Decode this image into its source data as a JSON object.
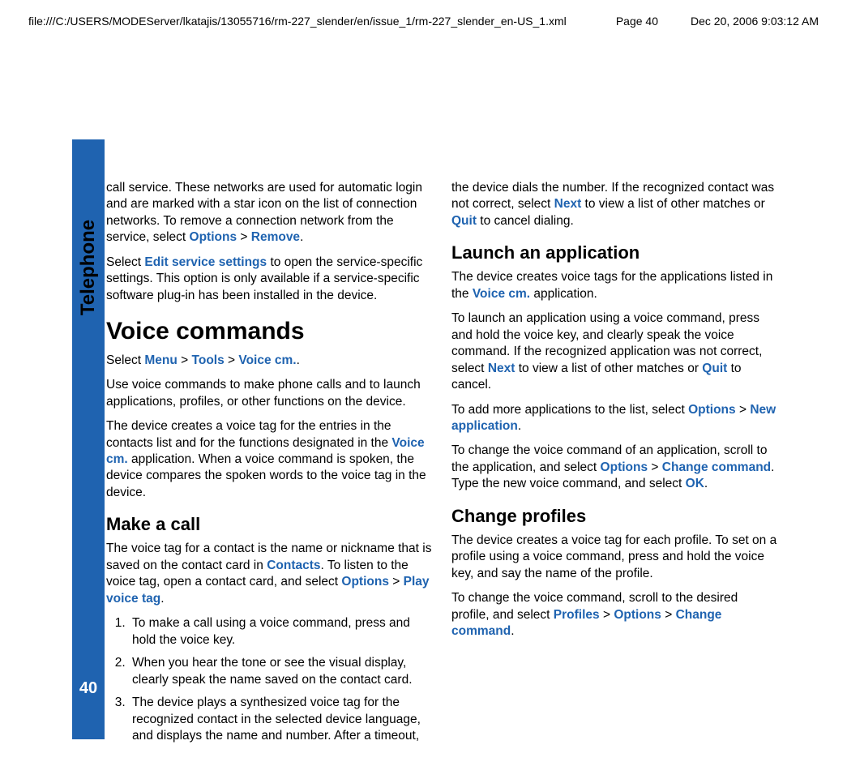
{
  "header": {
    "path": "file:///C:/USERS/MODEServer/lkatajis/13055716/rm-227_slender/en/issue_1/rm-227_slender_en-US_1.xml",
    "page": "Page 40",
    "date": "Dec 20, 2006 9:03:12 AM"
  },
  "side": {
    "label": "Telephone",
    "page_number": "40"
  },
  "left": {
    "p1a": "call service. These networks are used for automatic login and are marked with a star icon on the list of connection networks. To remove a connection network from the service, select ",
    "p1_opt": "Options",
    "p1_gt": " > ",
    "p1_rem": "Remove",
    "p1b": ".",
    "p2a": "Select ",
    "p2_edit": "Edit service settings",
    "p2b": " to open the service-specific settings. This option is only available if a service-specific software plug-in has been installed in the device.",
    "h1": "Voice commands",
    "p3a": "Select ",
    "p3_menu": "Menu",
    "p3_gt1": " > ",
    "p3_tools": "Tools",
    "p3_gt2": " > ",
    "p3_vc": "Voice cm.",
    "p3b": ".",
    "p4": "Use voice commands to make phone calls and to launch applications, profiles, or other functions on the device.",
    "p5a": "The device creates a voice tag for the entries in the contacts list and for the functions designated in the ",
    "p5_vc": "Voice cm.",
    "p5b": " application. When a voice command is spoken, the device compares the spoken words to the voice tag in the device.",
    "h2_make": "Make a call",
    "p6a": "The voice tag for a contact is the name or nickname that is saved on the contact card in ",
    "p6_contacts": "Contacts",
    "p6b": ". To listen to the voice tag, open a contact card, and select ",
    "p6_opt": "Options",
    "p6_gt": " > ",
    "p6_play": "Play voice tag",
    "p6c": ".",
    "li1": "To make a call using a voice command, press and hold the voice key.",
    "li2": "When you hear the tone or see the visual display, clearly speak the name saved on the contact card.",
    "li3": "The device plays a synthesized voice tag for the recognized contact in the selected device language, and displays the name and number. After a timeout,"
  },
  "right": {
    "p1a": "the device dials the number. If the recognized contact was not correct, select ",
    "p1_next": "Next",
    "p1b": " to view a list of other matches or ",
    "p1_quit": "Quit",
    "p1c": " to cancel dialing.",
    "h2_launch": "Launch an application",
    "p2a": "The device creates voice tags for the applications listed in the ",
    "p2_vc": "Voice cm.",
    "p2b": " application.",
    "p3a": "To launch an application using a voice command, press and hold the voice key, and clearly speak the voice command. If the recognized application was not correct, select ",
    "p3_next": "Next",
    "p3b": " to view a list of other matches or ",
    "p3_quit": "Quit",
    "p3c": " to cancel.",
    "p4a": "To add more applications to the list, select ",
    "p4_opt": "Options",
    "p4_gt": " > ",
    "p4_new": "New application",
    "p4b": ".",
    "p5a": "To change the voice command of an application, scroll to the application, and select ",
    "p5_opt": "Options",
    "p5_gt": " > ",
    "p5_chg": "Change command",
    "p5b": ". Type the new voice command, and select ",
    "p5_ok": "OK",
    "p5c": ".",
    "h2_profiles": "Change profiles",
    "p6": "The device creates a voice tag for each profile. To set on a profile using a voice command, press and hold the voice key, and say the name of the profile.",
    "p7a": "To change the voice command, scroll to the desired profile, and select ",
    "p7_prof": "Profiles",
    "p7_gt1": " > ",
    "p7_opt": "Options",
    "p7_gt2": " > ",
    "p7_chg": "Change command",
    "p7b": "."
  }
}
